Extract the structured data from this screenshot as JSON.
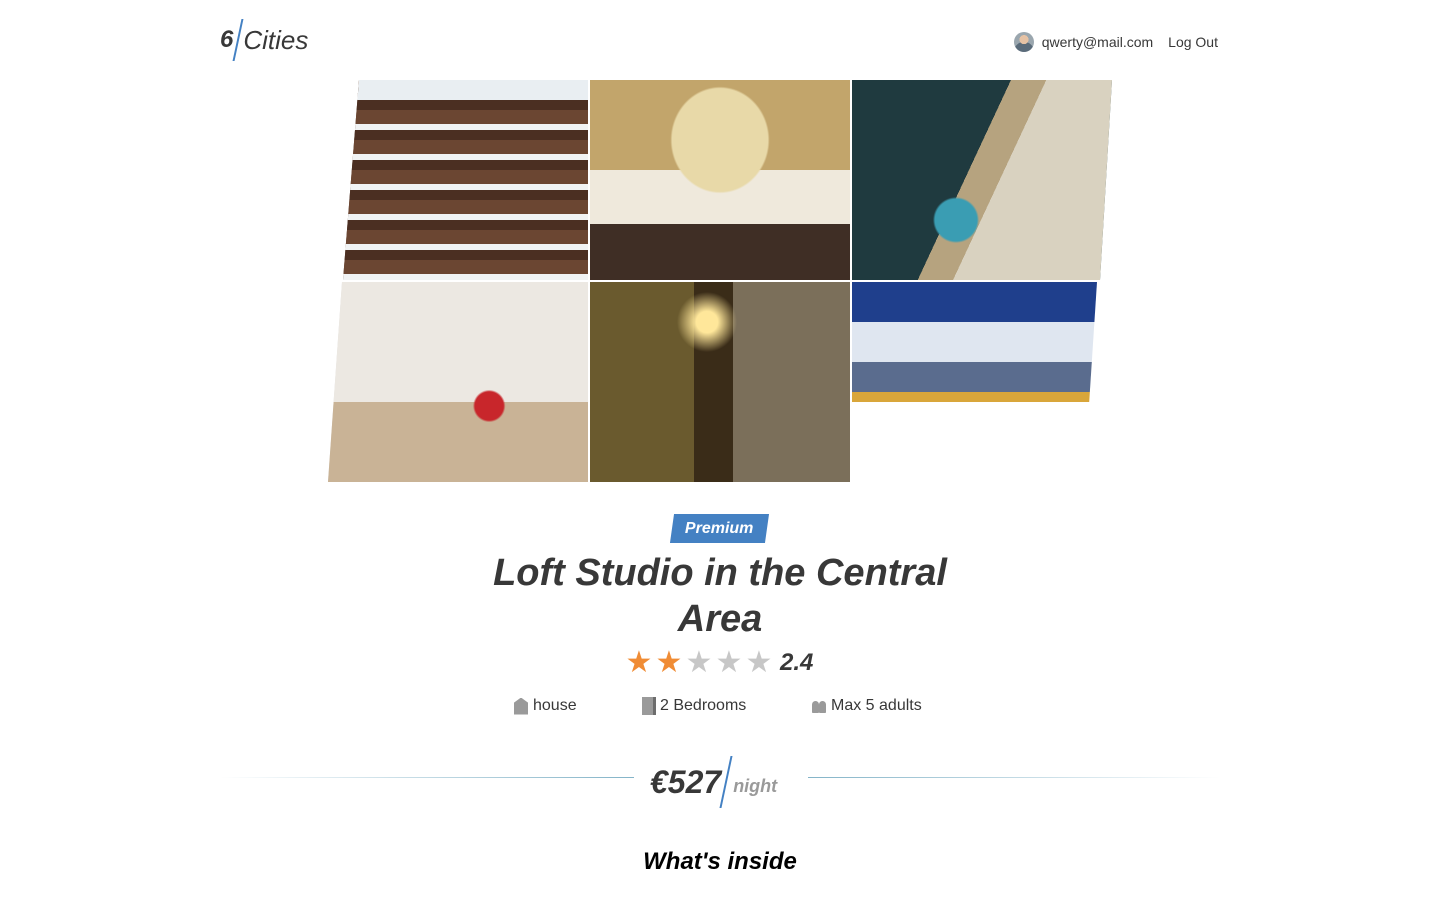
{
  "header": {
    "logo_number": "6",
    "logo_word": "Cities",
    "user_email": "qwerty@mail.com",
    "logout_label": "Log Out"
  },
  "gallery": {
    "images": [
      {
        "description": "Snowy alpine wooden hotel"
      },
      {
        "description": "Hotel bedroom with painting"
      },
      {
        "description": "Aerial view of resort pool by sea"
      },
      {
        "description": "Bright studio apartment interior"
      },
      {
        "description": "Narrow alley with hotel sign at night"
      },
      {
        "description": "Mountain hotel in snowy valley"
      }
    ]
  },
  "property": {
    "badge": "Premium",
    "title": "Loft Studio in the Central Area",
    "rating_value": "2.4",
    "rating_stars_filled": 2,
    "rating_stars_total": 5,
    "type": "house",
    "bedrooms": "2 Bedrooms",
    "max_adults": "Max 5 adults",
    "price": "€527",
    "price_unit": "night"
  },
  "sections": {
    "inside_title": "What's inside"
  },
  "colors": {
    "accent": "#4481c3",
    "star": "#f08c35",
    "text": "#383838"
  }
}
